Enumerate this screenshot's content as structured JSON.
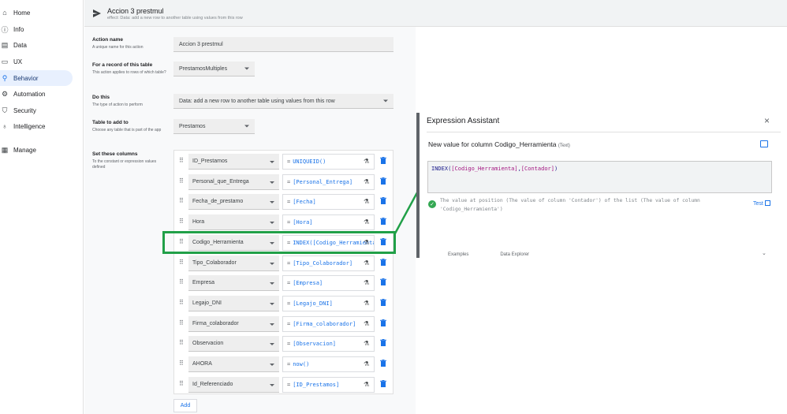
{
  "sidebar": {
    "items": [
      {
        "label": "Home",
        "icon": "home-icon",
        "glyph": "⌂"
      },
      {
        "label": "Info",
        "icon": "info-icon",
        "glyph": "ⓘ"
      },
      {
        "label": "Data",
        "icon": "data-icon",
        "glyph": "▤"
      },
      {
        "label": "UX",
        "icon": "ux-icon",
        "glyph": "▭"
      },
      {
        "label": "Behavior",
        "icon": "behavior-icon",
        "glyph": "⚲"
      },
      {
        "label": "Automation",
        "icon": "automation-icon",
        "glyph": "⚙"
      },
      {
        "label": "Security",
        "icon": "shield-icon",
        "glyph": "⛉"
      },
      {
        "label": "Intelligence",
        "icon": "bulb-icon",
        "glyph": "♁"
      },
      {
        "label": "Manage",
        "icon": "manage-icon",
        "glyph": "▦"
      }
    ],
    "active": "Behavior"
  },
  "header": {
    "title": "Accion 3 prestmul",
    "subtitle": "effect: Data: add a new row to another table using values from this row"
  },
  "form": {
    "action_name": {
      "label": "Action name",
      "hint": "A unique name for this action",
      "value": "Accion 3 prestmul"
    },
    "record_table": {
      "label": "For a record of this table",
      "hint": "This action applies to rows of which table?",
      "value": "PrestamosMultiples"
    },
    "do_this": {
      "label": "Do this",
      "hint": "The type of action to perform",
      "value": "Data: add a new row to another table using values from this row"
    },
    "table_to_add": {
      "label": "Table to add to",
      "hint": "Choose any table that is part of the app",
      "value": "Prestamos"
    },
    "set_columns": {
      "label": "Set these columns",
      "hint": "To the constant or expression values defined"
    },
    "columns": [
      {
        "column": "ID_Prestamos",
        "expr": "UNIQUEID()"
      },
      {
        "column": "Personal_que_Entrega",
        "expr": "[Personal_Entrega]"
      },
      {
        "column": "Fecha_de_prestamo",
        "expr": "[Fecha]"
      },
      {
        "column": "Hora",
        "expr": "[Hora]"
      },
      {
        "column": "Codigo_Herramienta",
        "expr": "INDEX([Codigo_Herramienta],[Contador])"
      },
      {
        "column": "Tipo_Colaborador",
        "expr": "[Tipo_Colaborador]"
      },
      {
        "column": "Empresa",
        "expr": "[Empresa]"
      },
      {
        "column": "Legajo_DNI",
        "expr": "[Legajo_DNI]"
      },
      {
        "column": "Firma_colaborador",
        "expr": "[Firma_colaborador]"
      },
      {
        "column": "Observacion",
        "expr": "[Observacion]"
      },
      {
        "column": "AHORA",
        "expr": "now()"
      },
      {
        "column": "Id_Referenciado",
        "expr": "[ID_Prestamos]"
      }
    ],
    "equals": "=",
    "add_label": "Add"
  },
  "assistant": {
    "title": "Expression Assistant",
    "close": "×",
    "new_value_label": "New value for column Codigo_Herramienta",
    "type": "(Text)",
    "code": {
      "fn": "INDEX(",
      "ref1": "[Codigo_Herramienta]",
      "comma": ",",
      "ref2": "[Contador]",
      "close": ")"
    },
    "description": "The value at position (The value of column 'Contador') of the list (The value of column 'Codigo_Herramienta')",
    "test_label": "Test",
    "tabs": [
      "Examples",
      "Data Explorer"
    ]
  },
  "colors": {
    "accent": "#1a73e8",
    "highlight": "#21a048",
    "active_bg": "#e8f0fe"
  }
}
